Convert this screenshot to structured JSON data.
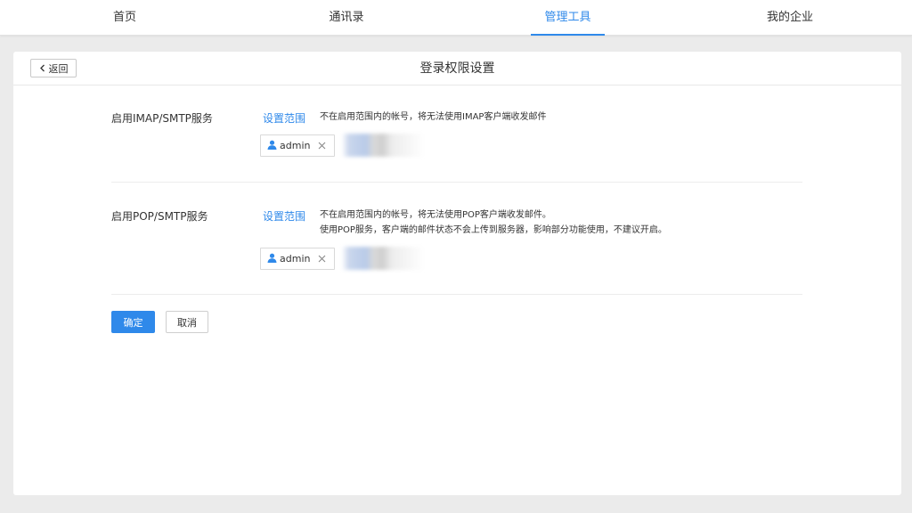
{
  "nav": {
    "items": [
      {
        "label": "首页"
      },
      {
        "label": "通讯录"
      },
      {
        "label": "管理工具"
      },
      {
        "label": "我的企业"
      }
    ],
    "active_index": 2
  },
  "header": {
    "back_label": "返回",
    "title": "登录权限设置"
  },
  "imap": {
    "label": "启用IMAP/SMTP服务",
    "scope_link": "设置范围",
    "desc": "不在启用范围内的帐号，将无法使用IMAP客户端收发邮件",
    "chip_label": "admin"
  },
  "pop": {
    "label": "启用POP/SMTP服务",
    "scope_link": "设置范围",
    "desc_line1": "不在启用范围内的帐号，将无法使用POP客户端收发邮件。",
    "desc_line2": "使用POP服务，客户端的邮件状态不会上传到服务器，影响部分功能使用，不建议开启。",
    "chip_label": "admin"
  },
  "actions": {
    "confirm_label": "确定",
    "cancel_label": "取消"
  },
  "colors": {
    "accent": "#2f89ea",
    "background": "#ebebeb"
  }
}
